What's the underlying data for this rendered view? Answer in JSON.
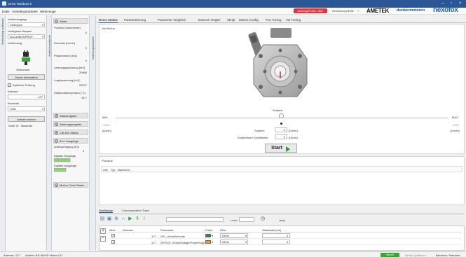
{
  "window": {
    "title": "Drive Rainbow 5"
  },
  "menu": [
    "Datei",
    "Antriebsparameter",
    "Werkzeuge"
  ],
  "header": {
    "warning_button": "Achtung/Fehler offen",
    "links": [
      "Einstellungen",
      "Hilfe",
      "?"
    ],
    "brand_ametek": "AMETEK",
    "brand_dunker": "dunkermotoren",
    "brand_nexo": "nexofox"
  },
  "left_panel": {
    "vtab_label": "Verbindung aufbauen",
    "conn_type_label": "Verbindungstyp",
    "conn_type_value": "CANOpen",
    "adapter_label": "Verfügbare Adapter",
    "adapter_value": "nicCanBUS/PROF...",
    "conn_label": "Verbindung",
    "connected_label": "Verbunden",
    "send_info_button": "Sende Information",
    "checksum_label": "Zyklische Prüfung",
    "address_label": "Adresse",
    "address_value": "127",
    "baudrate_label": "Baudrate",
    "baudrate_value": "125k",
    "search_button": "Antrieb suchen",
    "node_id_header": "Node ID",
    "baudrate_header": "Baudrate"
  },
  "mid_panel": {
    "vtab_label": "Antriebszustände",
    "values_section": "Werte",
    "rows": [
      {
        "label": "Position [Inkremente]",
        "value": "0"
      },
      {
        "label": "Drehzahl [U/min]",
        "value": "0"
      },
      {
        "label": "Phasenstrom [mA]",
        "value": "0"
      },
      {
        "label": "Leistungsspannung [mV]",
        "value": "20968"
      },
      {
        "label": "Logikspannung [mV]",
        "value": "23077"
      },
      {
        "label": "Elektroniktemperatur [°C]",
        "value": "26.7"
      }
    ],
    "sections": [
      "Statusregister",
      "Warnungsregister",
      "CiA 402 Status",
      "Ein-/ Ausgänge"
    ],
    "analog_label": "Analogeingang [mV]",
    "analog_value": "0",
    "din_label": "Digitale Eingänge",
    "dout_label": "Digitale Ausgänge",
    "motion_section": "Motion Code Status"
  },
  "right_vtab": "Antriebsparameter",
  "tabs": [
    "Demo Modus",
    "Parametrierung",
    "Parameter Vergleich",
    "Externer Regler",
    "Skript",
    "Motion Config",
    "Pos Tuning",
    "Vel Tuning"
  ],
  "demo": {
    "mode_label": "Vel Modus",
    "setpoint_label": "Sollwert",
    "min_label": "MIN",
    "max_label": "MAX",
    "min_value": "-3000",
    "max_value": "3000",
    "unit_left": "[U/min]",
    "unit_right": "[U/min]",
    "setpoint_row_label": "Sollwert",
    "setpoint_row_value": "0",
    "setpoint_row_unit": "[U/min]",
    "step_label": "Sollwertwert Schrittweite",
    "step_value": "1",
    "step_unit": "[U/min]",
    "start_button": "Start"
  },
  "protocol": {
    "title": "Protokoll",
    "columns": [
      "Zeit",
      "Typ",
      "Nachricht"
    ]
  },
  "lower_tabs": [
    "Oszilloskop",
    "Communication Trace"
  ],
  "toolbar": {
    "level_label": "Level",
    "unit_label": "[ms]"
  },
  "grid": {
    "columns": [
      "Aktiv",
      "Adresse",
      "Parameter",
      "Farbe",
      "Filter",
      "Abtastrate [ms]"
    ],
    "rows": [
      {
        "active": "✓",
        "address": "127",
        "param": "VEL_ActualVelocity",
        "color": "#2e8b2e",
        "filter": "Ohne",
        "rate": "4"
      },
      {
        "active": "✓",
        "address": "127",
        "param": "DEVICE_ActualVoltage/PowerSupp",
        "color": "#f0a020",
        "filter": "Ohne",
        "rate": "4"
      }
    ]
  },
  "status": {
    "address": "Adresse: 127",
    "drive": "Antrieb: BG 66X25 dNbus CO",
    "ready": "Bereit",
    "trace_button": "Fehler Quittieren",
    "user": "Benutzer: Standard"
  }
}
